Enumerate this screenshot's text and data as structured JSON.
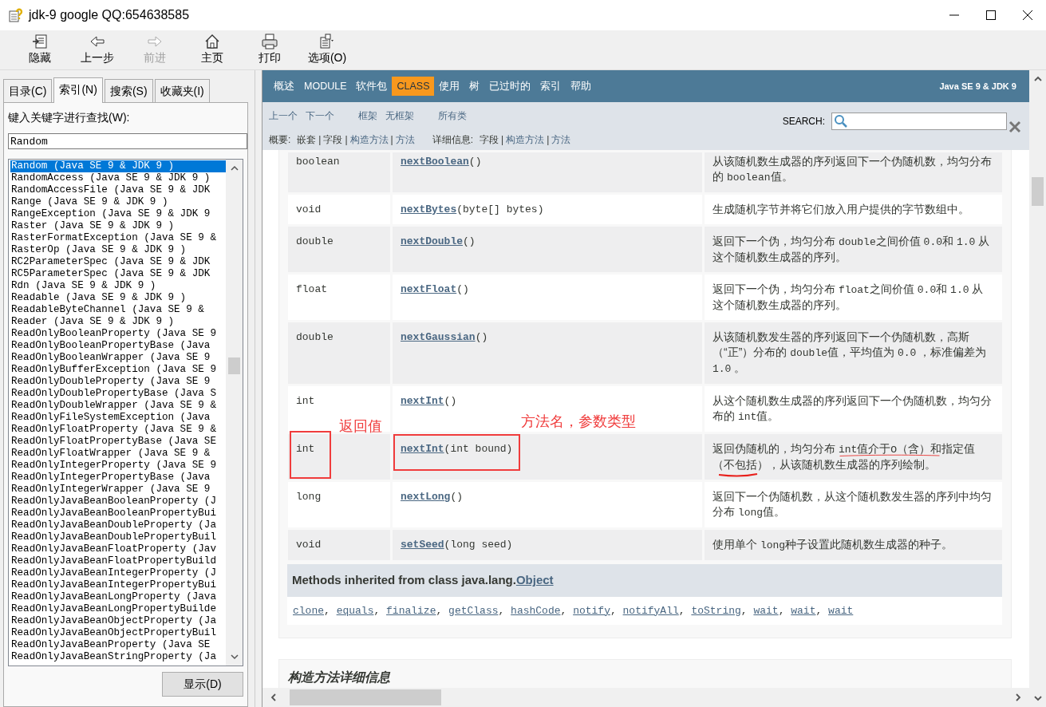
{
  "window": {
    "title": "jdk-9 google QQ:654638585"
  },
  "toolbar": [
    {
      "label": "隐藏",
      "kind": "hide",
      "disabled": false
    },
    {
      "label": "上一步",
      "kind": "back",
      "disabled": false
    },
    {
      "label": "前进",
      "kind": "forward",
      "disabled": true
    },
    {
      "label": "主页",
      "kind": "home",
      "disabled": false
    },
    {
      "label": "打印",
      "kind": "print",
      "disabled": false
    },
    {
      "label": "选项(O)",
      "kind": "options",
      "disabled": false
    }
  ],
  "left_pane": {
    "tabs": [
      {
        "label": "目录(C)",
        "selected": false
      },
      {
        "label": "索引(N)",
        "selected": true
      },
      {
        "label": "搜索(S)",
        "selected": false
      },
      {
        "label": "收藏夹(I)",
        "selected": false
      }
    ],
    "keyword_label": "键入关键字进行查找(W):",
    "keyword_value": "Random",
    "index_items": [
      {
        "text": "Random (Java SE 9 & JDK 9 )",
        "selected": true
      },
      {
        "text": "RandomAccess (Java SE 9 & JDK 9 )",
        "selected": false
      },
      {
        "text": "RandomAccessFile (Java SE 9 & JDK",
        "selected": false
      },
      {
        "text": "Range (Java SE 9 & JDK 9 )",
        "selected": false
      },
      {
        "text": "RangeException (Java SE 9 & JDK 9",
        "selected": false
      },
      {
        "text": "Raster (Java SE 9 & JDK 9 )",
        "selected": false
      },
      {
        "text": "RasterFormatException (Java SE 9 &",
        "selected": false
      },
      {
        "text": "RasterOp (Java SE 9 & JDK 9 )",
        "selected": false
      },
      {
        "text": "RC2ParameterSpec (Java SE 9 & JDK",
        "selected": false
      },
      {
        "text": "RC5ParameterSpec (Java SE 9 & JDK",
        "selected": false
      },
      {
        "text": "Rdn (Java SE 9 & JDK 9 )",
        "selected": false
      },
      {
        "text": "Readable (Java SE 9 & JDK 9 )",
        "selected": false
      },
      {
        "text": "ReadableByteChannel (Java SE 9 &",
        "selected": false
      },
      {
        "text": "Reader (Java SE 9 & JDK 9 )",
        "selected": false
      },
      {
        "text": "ReadOnlyBooleanProperty (Java SE 9",
        "selected": false
      },
      {
        "text": "ReadOnlyBooleanPropertyBase (Java",
        "selected": false
      },
      {
        "text": "ReadOnlyBooleanWrapper (Java SE 9",
        "selected": false
      },
      {
        "text": "ReadOnlyBufferException (Java SE 9",
        "selected": false
      },
      {
        "text": "ReadOnlyDoubleProperty (Java SE 9",
        "selected": false
      },
      {
        "text": "ReadOnlyDoublePropertyBase (Java S",
        "selected": false
      },
      {
        "text": "ReadOnlyDoubleWrapper (Java SE 9 &",
        "selected": false
      },
      {
        "text": "ReadOnlyFileSystemException (Java",
        "selected": false
      },
      {
        "text": "ReadOnlyFloatProperty (Java SE 9 &",
        "selected": false
      },
      {
        "text": "ReadOnlyFloatPropertyBase (Java SE",
        "selected": false
      },
      {
        "text": "ReadOnlyFloatWrapper (Java SE 9 &",
        "selected": false
      },
      {
        "text": "ReadOnlyIntegerProperty (Java SE 9",
        "selected": false
      },
      {
        "text": "ReadOnlyIntegerPropertyBase (Java",
        "selected": false
      },
      {
        "text": "ReadOnlyIntegerWrapper (Java SE 9",
        "selected": false
      },
      {
        "text": "ReadOnlyJavaBeanBooleanProperty (J",
        "selected": false
      },
      {
        "text": "ReadOnlyJavaBeanBooleanPropertyBui",
        "selected": false
      },
      {
        "text": "ReadOnlyJavaBeanDoubleProperty (Ja",
        "selected": false
      },
      {
        "text": "ReadOnlyJavaBeanDoublePropertyBuil",
        "selected": false
      },
      {
        "text": "ReadOnlyJavaBeanFloatProperty (Jav",
        "selected": false
      },
      {
        "text": "ReadOnlyJavaBeanFloatPropertyBuild",
        "selected": false
      },
      {
        "text": "ReadOnlyJavaBeanIntegerProperty (J",
        "selected": false
      },
      {
        "text": "ReadOnlyJavaBeanIntegerPropertyBui",
        "selected": false
      },
      {
        "text": "ReadOnlyJavaBeanLongProperty (Java",
        "selected": false
      },
      {
        "text": "ReadOnlyJavaBeanLongPropertyBuilde",
        "selected": false
      },
      {
        "text": "ReadOnlyJavaBeanObjectProperty (Ja",
        "selected": false
      },
      {
        "text": "ReadOnlyJavaBeanObjectPropertyBuil",
        "selected": false
      },
      {
        "text": "ReadOnlyJavaBeanProperty (Java SE",
        "selected": false
      },
      {
        "text": "ReadOnlyJavaBeanStringProperty (Ja",
        "selected": false
      }
    ],
    "display_button": "显示(D)"
  },
  "doc": {
    "nav": [
      {
        "label": "概述",
        "selected": false
      },
      {
        "label": "MODULE",
        "selected": false
      },
      {
        "label": "软件包",
        "selected": false
      },
      {
        "label": "CLASS",
        "selected": true
      },
      {
        "label": "使用",
        "selected": false
      },
      {
        "label": "树",
        "selected": false
      },
      {
        "label": "已过时的",
        "selected": false
      },
      {
        "label": "索引",
        "selected": false
      },
      {
        "label": "帮助",
        "selected": false
      }
    ],
    "version": "Java SE 9 & JDK 9",
    "subnav_groups": [
      [
        "上一个",
        "下一个"
      ],
      [
        "框架",
        "无框架"
      ],
      [
        "所有类"
      ]
    ],
    "search_label": "SEARCH:",
    "summary": {
      "label": "概要:",
      "separator": "|",
      "items": [
        {
          "text": "嵌套",
          "link": false
        },
        {
          "text": "字段",
          "link": false
        },
        {
          "text": "构造方法",
          "link": true
        },
        {
          "text": "方法",
          "link": true
        }
      ]
    },
    "detail": {
      "label": "详细信息:",
      "separator": "|",
      "items": [
        {
          "text": "字段",
          "link": false
        },
        {
          "text": "构造方法",
          "link": true
        },
        {
          "text": "方法",
          "link": true
        }
      ]
    },
    "methods": [
      {
        "type": "boolean",
        "name": "nextBoolean",
        "params": "()",
        "description": [
          {
            "kind": "text",
            "text": "从该随机数生成器的序列返回下一个伪随机数，均匀分布的 "
          },
          {
            "kind": "code",
            "text": "boolean"
          },
          {
            "kind": "text",
            "text": "值。"
          }
        ]
      },
      {
        "type": "void",
        "name": "nextBytes",
        "params": "(byte[] bytes)",
        "description": [
          {
            "kind": "text",
            "text": "生成随机字节并将它们放入用户提供的字节数组中。"
          }
        ]
      },
      {
        "type": "double",
        "name": "nextDouble",
        "params": "()",
        "description": [
          {
            "kind": "text",
            "text": "返回下一个伪，均匀分布 "
          },
          {
            "kind": "code",
            "text": "double"
          },
          {
            "kind": "text",
            "text": "之间价值 "
          },
          {
            "kind": "code",
            "text": "0.0"
          },
          {
            "kind": "text",
            "text": "和 "
          },
          {
            "kind": "code",
            "text": "1.0"
          },
          {
            "kind": "text",
            "text": " 从这个随机数生成器的序列。"
          }
        ]
      },
      {
        "type": "float",
        "name": "nextFloat",
        "params": "()",
        "description": [
          {
            "kind": "text",
            "text": "返回下一个伪，均匀分布 "
          },
          {
            "kind": "code",
            "text": "float"
          },
          {
            "kind": "text",
            "text": "之间价值 "
          },
          {
            "kind": "code",
            "text": "0.0"
          },
          {
            "kind": "text",
            "text": "和 "
          },
          {
            "kind": "code",
            "text": "1.0"
          },
          {
            "kind": "text",
            "text": " 从这个随机数生成器的序列。"
          }
        ]
      },
      {
        "type": "double",
        "name": "nextGaussian",
        "params": "()",
        "description": [
          {
            "kind": "text",
            "text": "从该随机数发生器的序列返回下一个伪随机数，高斯（“正”）分布的 "
          },
          {
            "kind": "code",
            "text": "double"
          },
          {
            "kind": "text",
            "text": "值，平均值为 "
          },
          {
            "kind": "code",
            "text": "0.0"
          },
          {
            "kind": "text",
            "text": " ，标准偏差为 "
          },
          {
            "kind": "code",
            "text": "1.0"
          },
          {
            "kind": "text",
            "text": " 。"
          }
        ]
      },
      {
        "type": "int",
        "name": "nextInt",
        "params": "()",
        "description": [
          {
            "kind": "text",
            "text": "从这个随机数生成器的序列返回下一个伪随机数，均匀分布的 "
          },
          {
            "kind": "code",
            "text": "int"
          },
          {
            "kind": "text",
            "text": "值。"
          }
        ]
      },
      {
        "type": "int",
        "name": "nextInt",
        "params": "(int bound)",
        "description": [
          {
            "kind": "text",
            "text": "返回伪随机的，均匀分布 "
          },
          {
            "kind": "code",
            "text": "int"
          },
          {
            "kind": "text",
            "text": "值介于o（含）和指定值（不包括），从该随机数生成器的序列绘制。"
          }
        ],
        "annotation": {
          "type_label": "返回值",
          "method_label": "方法名，参数类型"
        }
      },
      {
        "type": "long",
        "name": "nextLong",
        "params": "()",
        "description": [
          {
            "kind": "text",
            "text": "返回下一个伪随机数，从这个随机数发生器的序列中均匀分布 "
          },
          {
            "kind": "code",
            "text": "long"
          },
          {
            "kind": "text",
            "text": "值。"
          }
        ]
      },
      {
        "type": "void",
        "name": "setSeed",
        "params": "(long seed)",
        "description": [
          {
            "kind": "text",
            "text": "使用单个 "
          },
          {
            "kind": "code",
            "text": "long"
          },
          {
            "kind": "text",
            "text": "种子设置此随机数生成器的种子。"
          }
        ]
      }
    ],
    "inherited": {
      "heading": "Methods inherited from class java.lang.",
      "class_link": "Object",
      "separator": ", ",
      "methods": [
        "clone",
        "equals",
        "finalize",
        "getClass",
        "hashCode",
        "notify",
        "notifyAll",
        "toString",
        "wait",
        "wait",
        "wait"
      ]
    },
    "next_section": "构造方法详细信息"
  }
}
